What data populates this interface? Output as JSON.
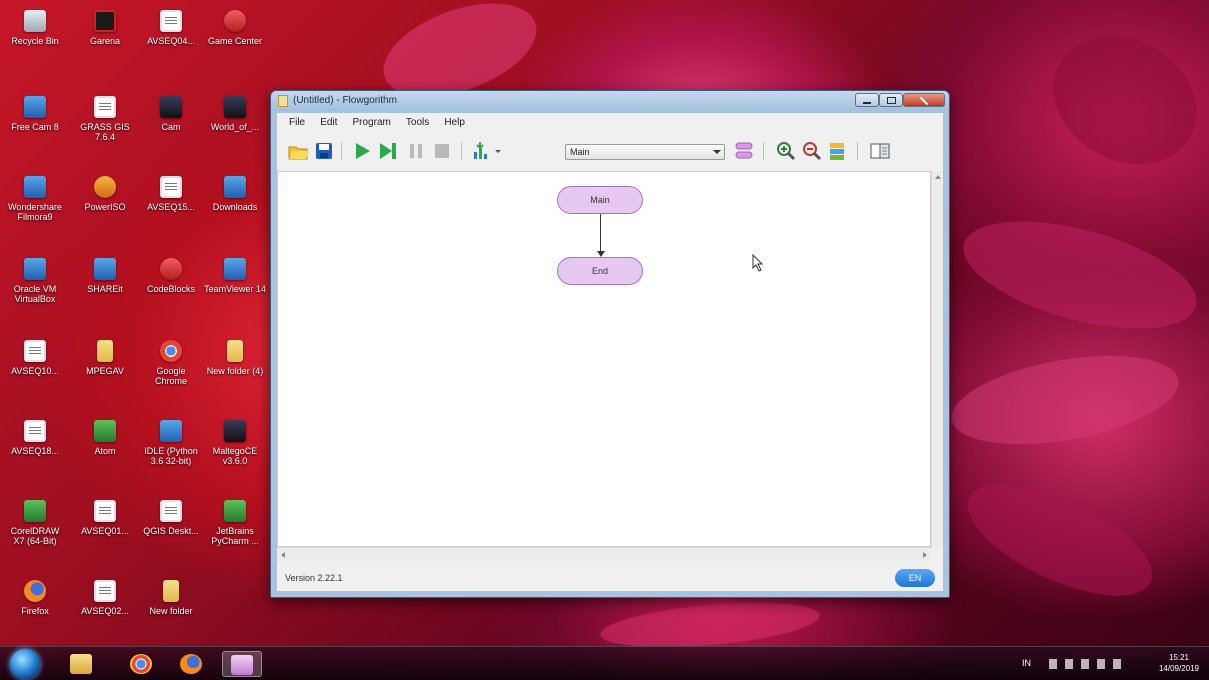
{
  "desktop": {
    "icons": [
      {
        "label": "Recycle Bin",
        "icon": "recycle-bin-icon"
      },
      {
        "label": "Garena",
        "icon": "game-icon"
      },
      {
        "label": "AVSEQ04...",
        "icon": "document-icon"
      },
      {
        "label": "Game Center",
        "icon": "game-center-icon"
      },
      {
        "label": "Free Cam 8",
        "icon": "camera-app-icon"
      },
      {
        "label": "GRASS GIS 7.6.4",
        "icon": "shortcut-icon"
      },
      {
        "label": "Cam",
        "icon": "camera-icon"
      },
      {
        "label": "World_of_...",
        "icon": "shortcut-icon"
      },
      {
        "label": "Wondershare Filmora9",
        "icon": "video-editor-icon"
      },
      {
        "label": "PowerISO",
        "icon": "disc-icon"
      },
      {
        "label": "AVSEQ15...",
        "icon": "document-icon"
      },
      {
        "label": "Downloads",
        "icon": "folder-shortcut-icon"
      },
      {
        "label": "Oracle VM VirtualBox",
        "icon": "virtualbox-icon"
      },
      {
        "label": "SHAREit",
        "icon": "share-app-icon"
      },
      {
        "label": "CodeBlocks",
        "icon": "codeblocks-icon"
      },
      {
        "label": "TeamViewer 14",
        "icon": "teamviewer-icon"
      },
      {
        "label": "AVSEQ10...",
        "icon": "document-icon"
      },
      {
        "label": "MPEGAV",
        "icon": "folder-icon"
      },
      {
        "label": "Google Chrome",
        "icon": "chrome-icon"
      },
      {
        "label": "New folder (4)",
        "icon": "folder-icon"
      },
      {
        "label": "AVSEQ18...",
        "icon": "document-icon"
      },
      {
        "label": "Atom",
        "icon": "atom-icon"
      },
      {
        "label": "IDLE (Python 3.6 32-bit)",
        "icon": "python-icon"
      },
      {
        "label": "MaltegoCE v3.6.0",
        "icon": "maltego-icon"
      },
      {
        "label": "CorelDRAW X7 (64-Bit)",
        "icon": "coreldraw-icon"
      },
      {
        "label": "AVSEQ01...",
        "icon": "document-icon"
      },
      {
        "label": "QGIS Deskt...",
        "icon": "qgis-icon"
      },
      {
        "label": "JetBrains PyCharm ...",
        "icon": "pycharm-icon"
      },
      {
        "label": "Firefox",
        "icon": "firefox-icon"
      },
      {
        "label": "AVSEQ02...",
        "icon": "document-icon"
      },
      {
        "label": "New folder",
        "icon": "folder-icon"
      }
    ]
  },
  "window": {
    "title": "(Untitled) - Flowgorithm",
    "menu": [
      "File",
      "Edit",
      "Program",
      "Tools",
      "Help"
    ],
    "toolbar": {
      "function_select": "Main"
    },
    "flowchart": {
      "start_node": "Main",
      "end_node": "End"
    },
    "status": {
      "version": "Version 2.22.1",
      "language_button": "EN"
    }
  },
  "taskbar": {
    "items": [
      "windows-explorer",
      "chrome",
      "firefox",
      "flowgorithm"
    ],
    "tray_language": "IN",
    "clock_time": "15:21",
    "clock_date": "14/09/2019"
  }
}
